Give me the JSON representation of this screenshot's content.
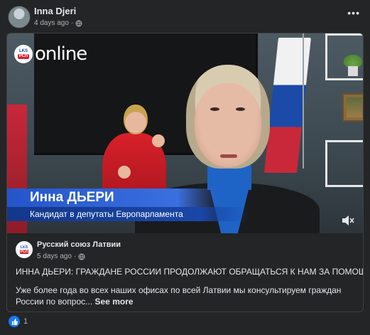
{
  "post": {
    "author": "Inna Djeri",
    "time": "4 days ago",
    "separator": "·",
    "more_label": "•••"
  },
  "video": {
    "channel_logo_top": "LKS",
    "channel_logo_bottom": "РСЛ",
    "channel_name": "online",
    "speaker_name": "Инна ДЬЕРИ",
    "speaker_role": "Кандидат в депутаты Европарламента",
    "muted": true
  },
  "shared": {
    "source_name": "Русский союз Латвии",
    "source_logo_top": "LKS",
    "source_logo_bottom": "РСЛ",
    "time": "5 days ago",
    "separator": "·",
    "headline": "ИННА ДЬЕРИ: ГРАЖДАНЕ РОССИИ ПРОДОЛЖАЮТ ОБРАЩАТЬСЯ К НАМ ЗА ПОМОЩЬЮ",
    "description": "Уже более года во всех наших офисах по всей Латвии мы консультируем граждан России по вопрос...",
    "see_more": "See more"
  },
  "reactions": {
    "count": "1",
    "type": "like"
  },
  "colors": {
    "background": "#242526",
    "text": "#e4e6eb",
    "muted_text": "#b0b3b8",
    "accent": "#1877f2"
  }
}
